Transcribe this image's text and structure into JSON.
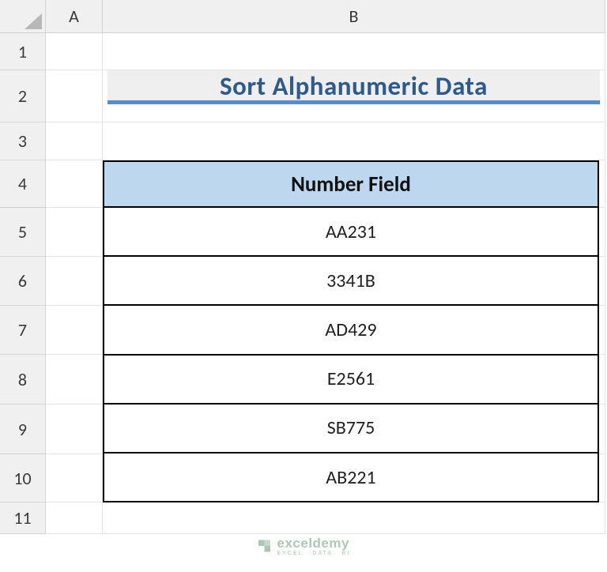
{
  "columns": [
    "A",
    "B"
  ],
  "rows": [
    "1",
    "2",
    "3",
    "4",
    "5",
    "6",
    "7",
    "8",
    "9",
    "10",
    "11"
  ],
  "title": "Sort Alphanumeric Data",
  "table": {
    "header": "Number Field",
    "data": [
      "AA231",
      "3341B",
      "AD429",
      "E2561",
      "SB775",
      "AB221"
    ]
  },
  "chart_data": {
    "type": "table",
    "title": "Sort Alphanumeric Data",
    "columns": [
      "Number Field"
    ],
    "rows": [
      [
        "AA231"
      ],
      [
        "3341B"
      ],
      [
        "AD429"
      ],
      [
        "E2561"
      ],
      [
        "SB775"
      ],
      [
        "AB221"
      ]
    ]
  },
  "watermark": {
    "brand": "exceldemy",
    "tagline": "EXCEL · DATA · BI"
  }
}
